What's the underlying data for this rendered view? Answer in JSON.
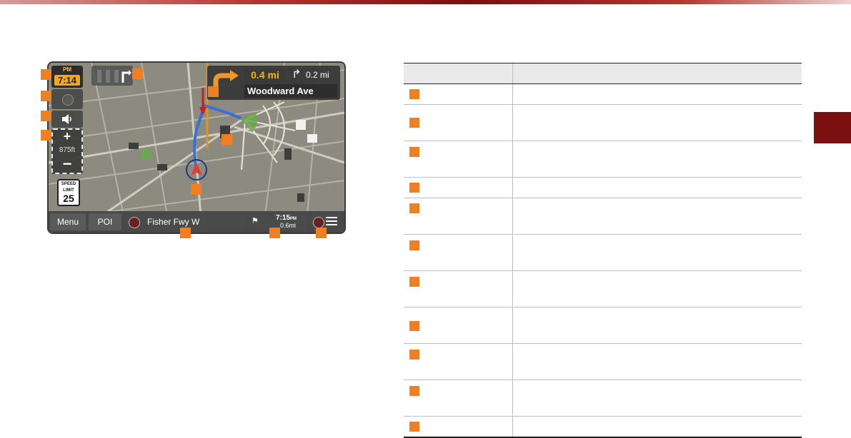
{
  "colors": {
    "accent": "#f07f22",
    "brand_dark_red": "#7a1010",
    "distance_yellow": "#f5b800"
  },
  "nav": {
    "clock": {
      "ampm": "PM",
      "time": "7:14"
    },
    "zoom": {
      "plus": "+",
      "scale": "875ft",
      "minus": "−"
    },
    "speed_limit": {
      "title_line1": "SPEED",
      "title_line2": "LIMIT",
      "value": "25"
    },
    "turn": {
      "distance": "0.4 mi",
      "next_distance": "0.2 mi",
      "street": "Woodward Ave",
      "next_icon": "turn-right-icon"
    },
    "bottom": {
      "menu_label": "Menu",
      "poi_label": "POI",
      "road_name": "Fisher Fwy W",
      "eta_time": "7:15",
      "eta_ampm": "PM",
      "eta_distance": "0.6mi"
    }
  },
  "table": {
    "header": [
      "",
      ""
    ],
    "row_count": 11
  }
}
